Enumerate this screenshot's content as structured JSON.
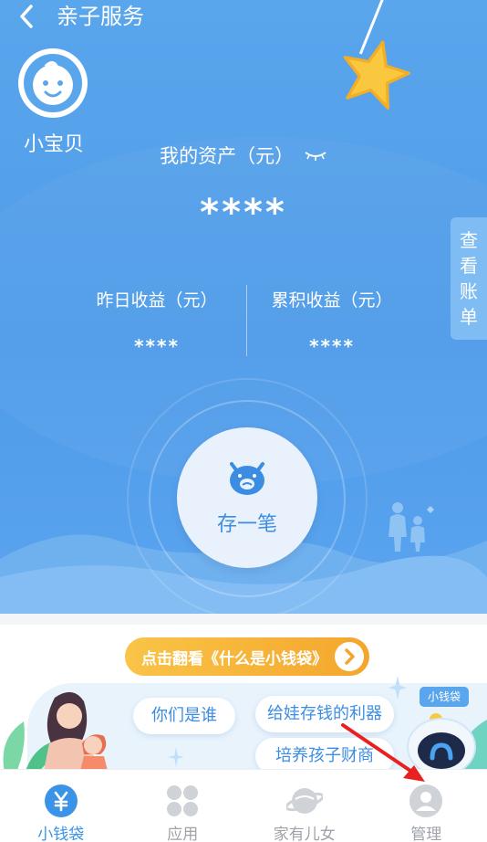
{
  "header": {
    "back_icon": "chevron-left-icon",
    "title": "亲子服务"
  },
  "child": {
    "name": "小宝贝",
    "avatar_icon": "baby-face-icon"
  },
  "assets": {
    "label": "我的资产（元）",
    "eye_icon": "eye-closed-icon",
    "value": "****"
  },
  "side_tab": {
    "label_chars": [
      "查",
      "看",
      "账",
      "单"
    ]
  },
  "stats": {
    "yesterday_label": "昨日收益（元）",
    "yesterday_value": "****",
    "total_label": "累积收益（元）",
    "total_value": "****"
  },
  "deposit": {
    "label": "存一笔",
    "icon": "piggy-bank-icon"
  },
  "intro": {
    "button_label": "点击翻看《什么是小钱袋》"
  },
  "pills": {
    "who": "你们是谁",
    "tool": "给娃存钱的利器",
    "finance": "培养孩子财商"
  },
  "mascot_tag": "小钱袋",
  "tabs": [
    {
      "label": "小钱袋",
      "icon": "yuan-icon",
      "active": true
    },
    {
      "label": "应用",
      "icon": "grid-icon",
      "active": false
    },
    {
      "label": "家有儿女",
      "icon": "planet-icon",
      "active": false
    },
    {
      "label": "管理",
      "icon": "user-icon",
      "active": false
    }
  ],
  "colors": {
    "primary": "#4f9be9",
    "accent_orange": "#f4a62c",
    "active_tab": "#3a93e6",
    "annotation_arrow": "#e82020"
  }
}
